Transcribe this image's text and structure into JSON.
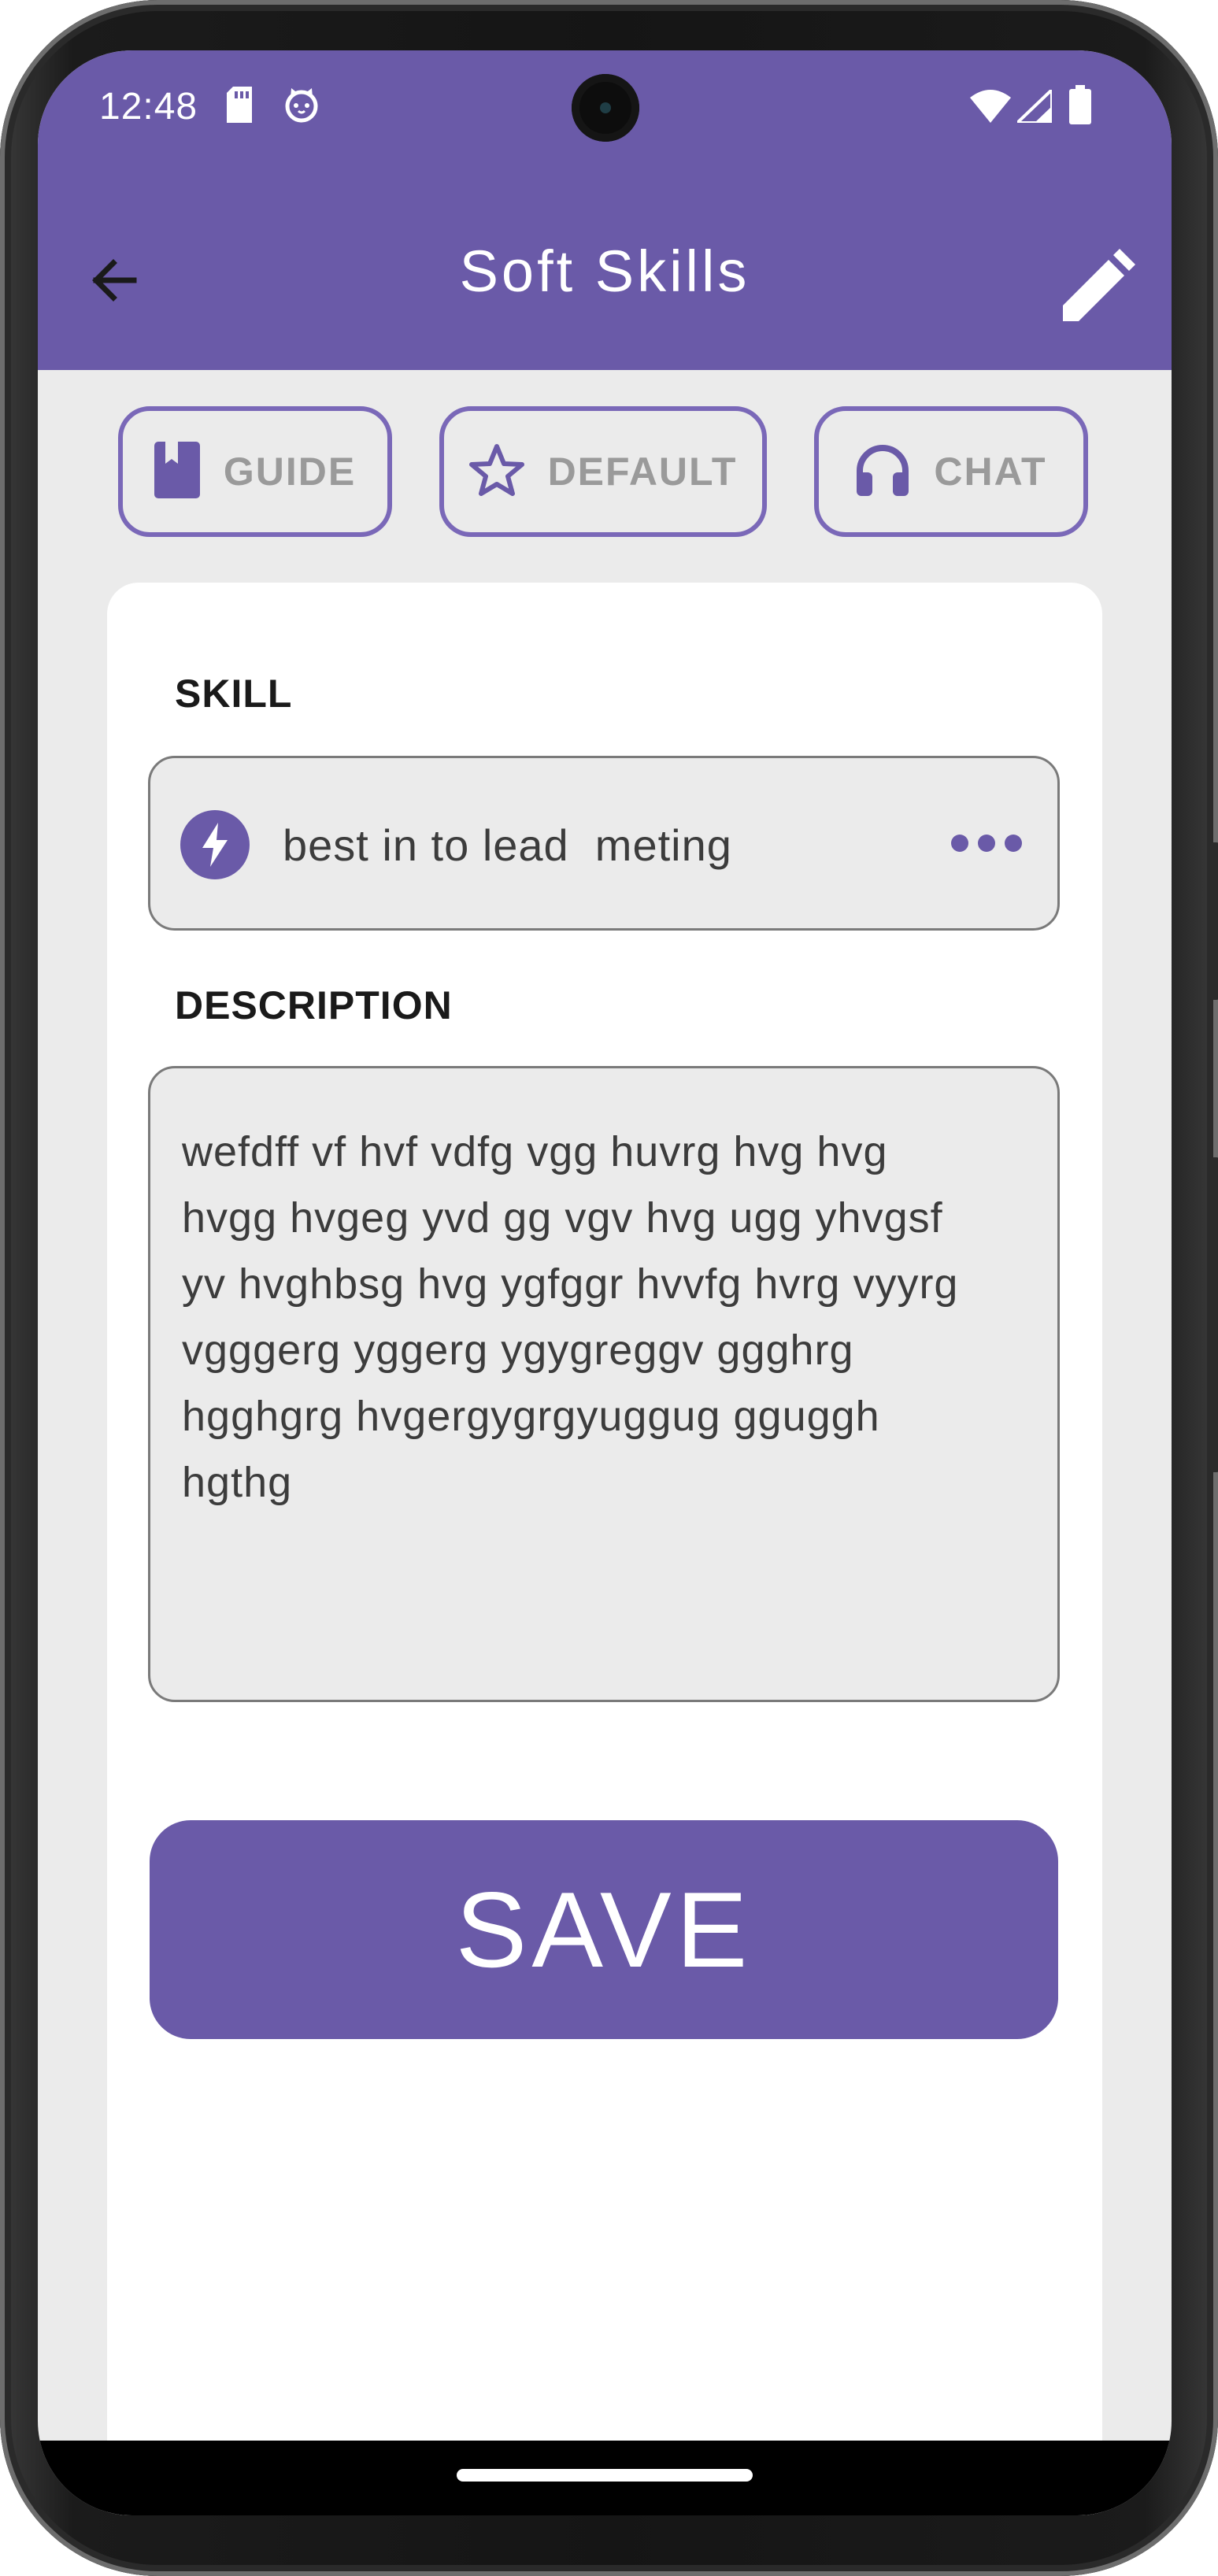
{
  "status_bar": {
    "time": "12:48",
    "left_icons": [
      "sd-card-icon",
      "cat-face-icon"
    ],
    "right_icons": [
      "wifi-icon",
      "cell-signal-icon",
      "battery-icon"
    ]
  },
  "app_bar": {
    "title": "Soft Skills",
    "back_icon": "arrow-left-icon",
    "edit_icon": "pencil-icon"
  },
  "chips": [
    {
      "label": "GUIDE",
      "icon": "book-icon"
    },
    {
      "label": "DEFAULT",
      "icon": "star-outline-icon"
    },
    {
      "label": "CHAT",
      "icon": "headphones-icon"
    }
  ],
  "form": {
    "skill_label": "SKILL",
    "skill_value": "best in to lead  meting",
    "skill_icon": "bolt-icon",
    "more_icon": "more-horizontal-icon",
    "description_label": "DESCRIPTION",
    "description_value": "wefdff vf hvf vdfg vgg huvrg hvg hvg\nhvgg hvgeg yvd gg vgv hvg ugg yhvgsf\nyv hvghbsg hvg ygfggr hvvfg hvrg vyyrg\nvgggerg yggerg ygygreggv ggghrg\nhgghgrg hvgergygrgyuggug  gguggh\nhgthg"
  },
  "save_button": {
    "label": "SAVE"
  },
  "colors": {
    "accent": "#6a5aa8",
    "chip_border": "#7a68b8",
    "screen_background": "#ebebeb",
    "card_background": "#ffffff"
  }
}
